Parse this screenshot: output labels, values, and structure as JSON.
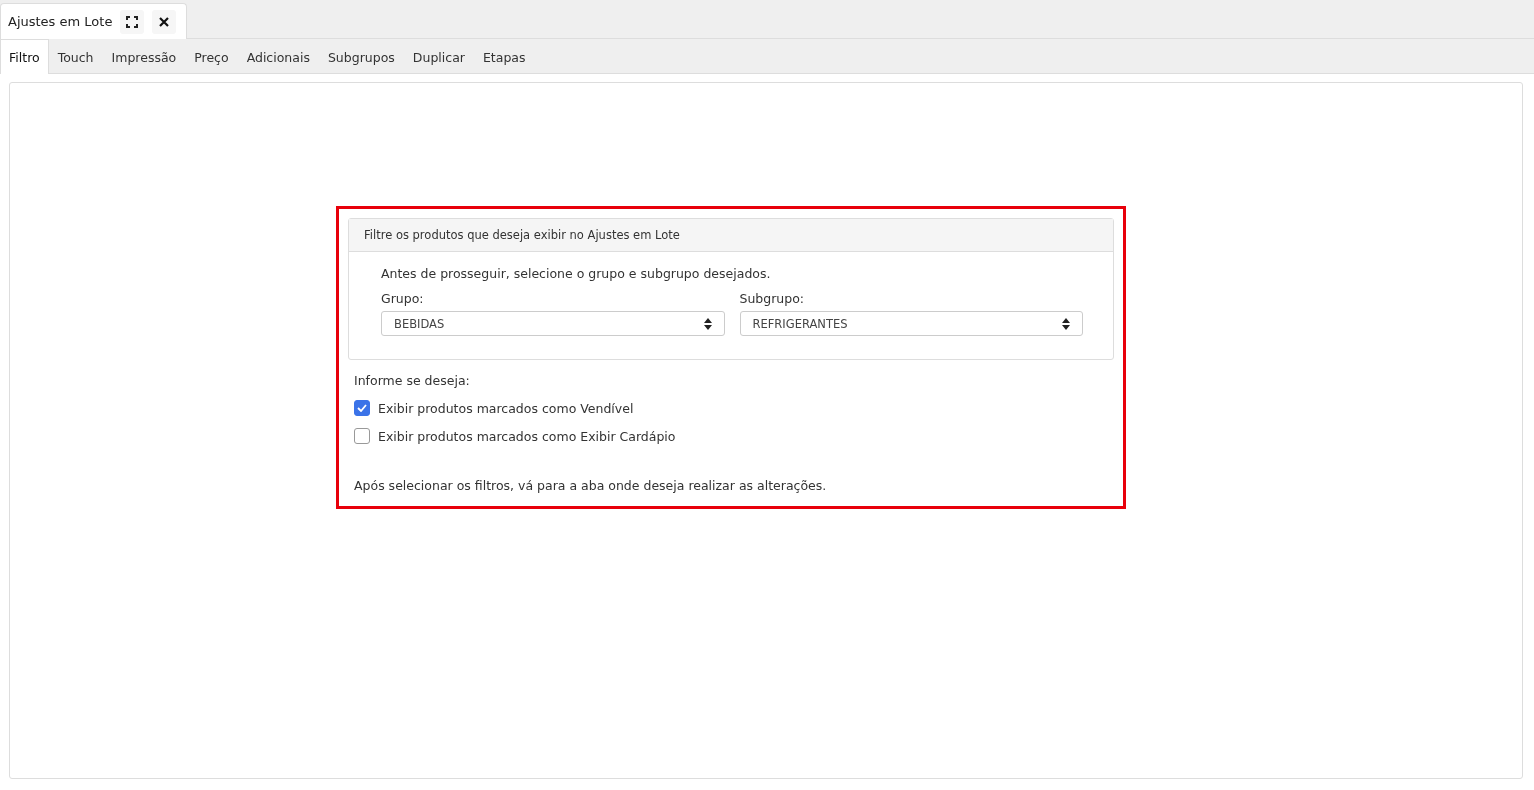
{
  "window_tab": {
    "title": "Ajustes em Lote"
  },
  "tabs": [
    {
      "label": "Filtro",
      "selected": true
    },
    {
      "label": "Touch",
      "selected": false
    },
    {
      "label": "Impressão",
      "selected": false
    },
    {
      "label": "Preço",
      "selected": false
    },
    {
      "label": "Adicionais",
      "selected": false
    },
    {
      "label": "Subgrupos",
      "selected": false
    },
    {
      "label": "Duplicar",
      "selected": false
    },
    {
      "label": "Etapas",
      "selected": false
    }
  ],
  "filter_card": {
    "header": "Filtre os produtos que deseja exibir no Ajustes em Lote",
    "intro": "Antes de prosseguir, selecione o grupo e subgrupo desejados.",
    "selects": [
      {
        "label": "Grupo:",
        "value": "BEBIDAS"
      },
      {
        "label": "Subgrupo:",
        "value": "REFRIGERANTES"
      }
    ]
  },
  "options_label": "Informe se deseja:",
  "options": [
    {
      "label": "Exibir produtos marcados como Vendível",
      "checked": true
    },
    {
      "label": "Exibir produtos marcados como Exibir Cardápio",
      "checked": false
    }
  ],
  "footer_note": "Após selecionar os filtros, vá para a aba onde deseja realizar as alterações."
}
